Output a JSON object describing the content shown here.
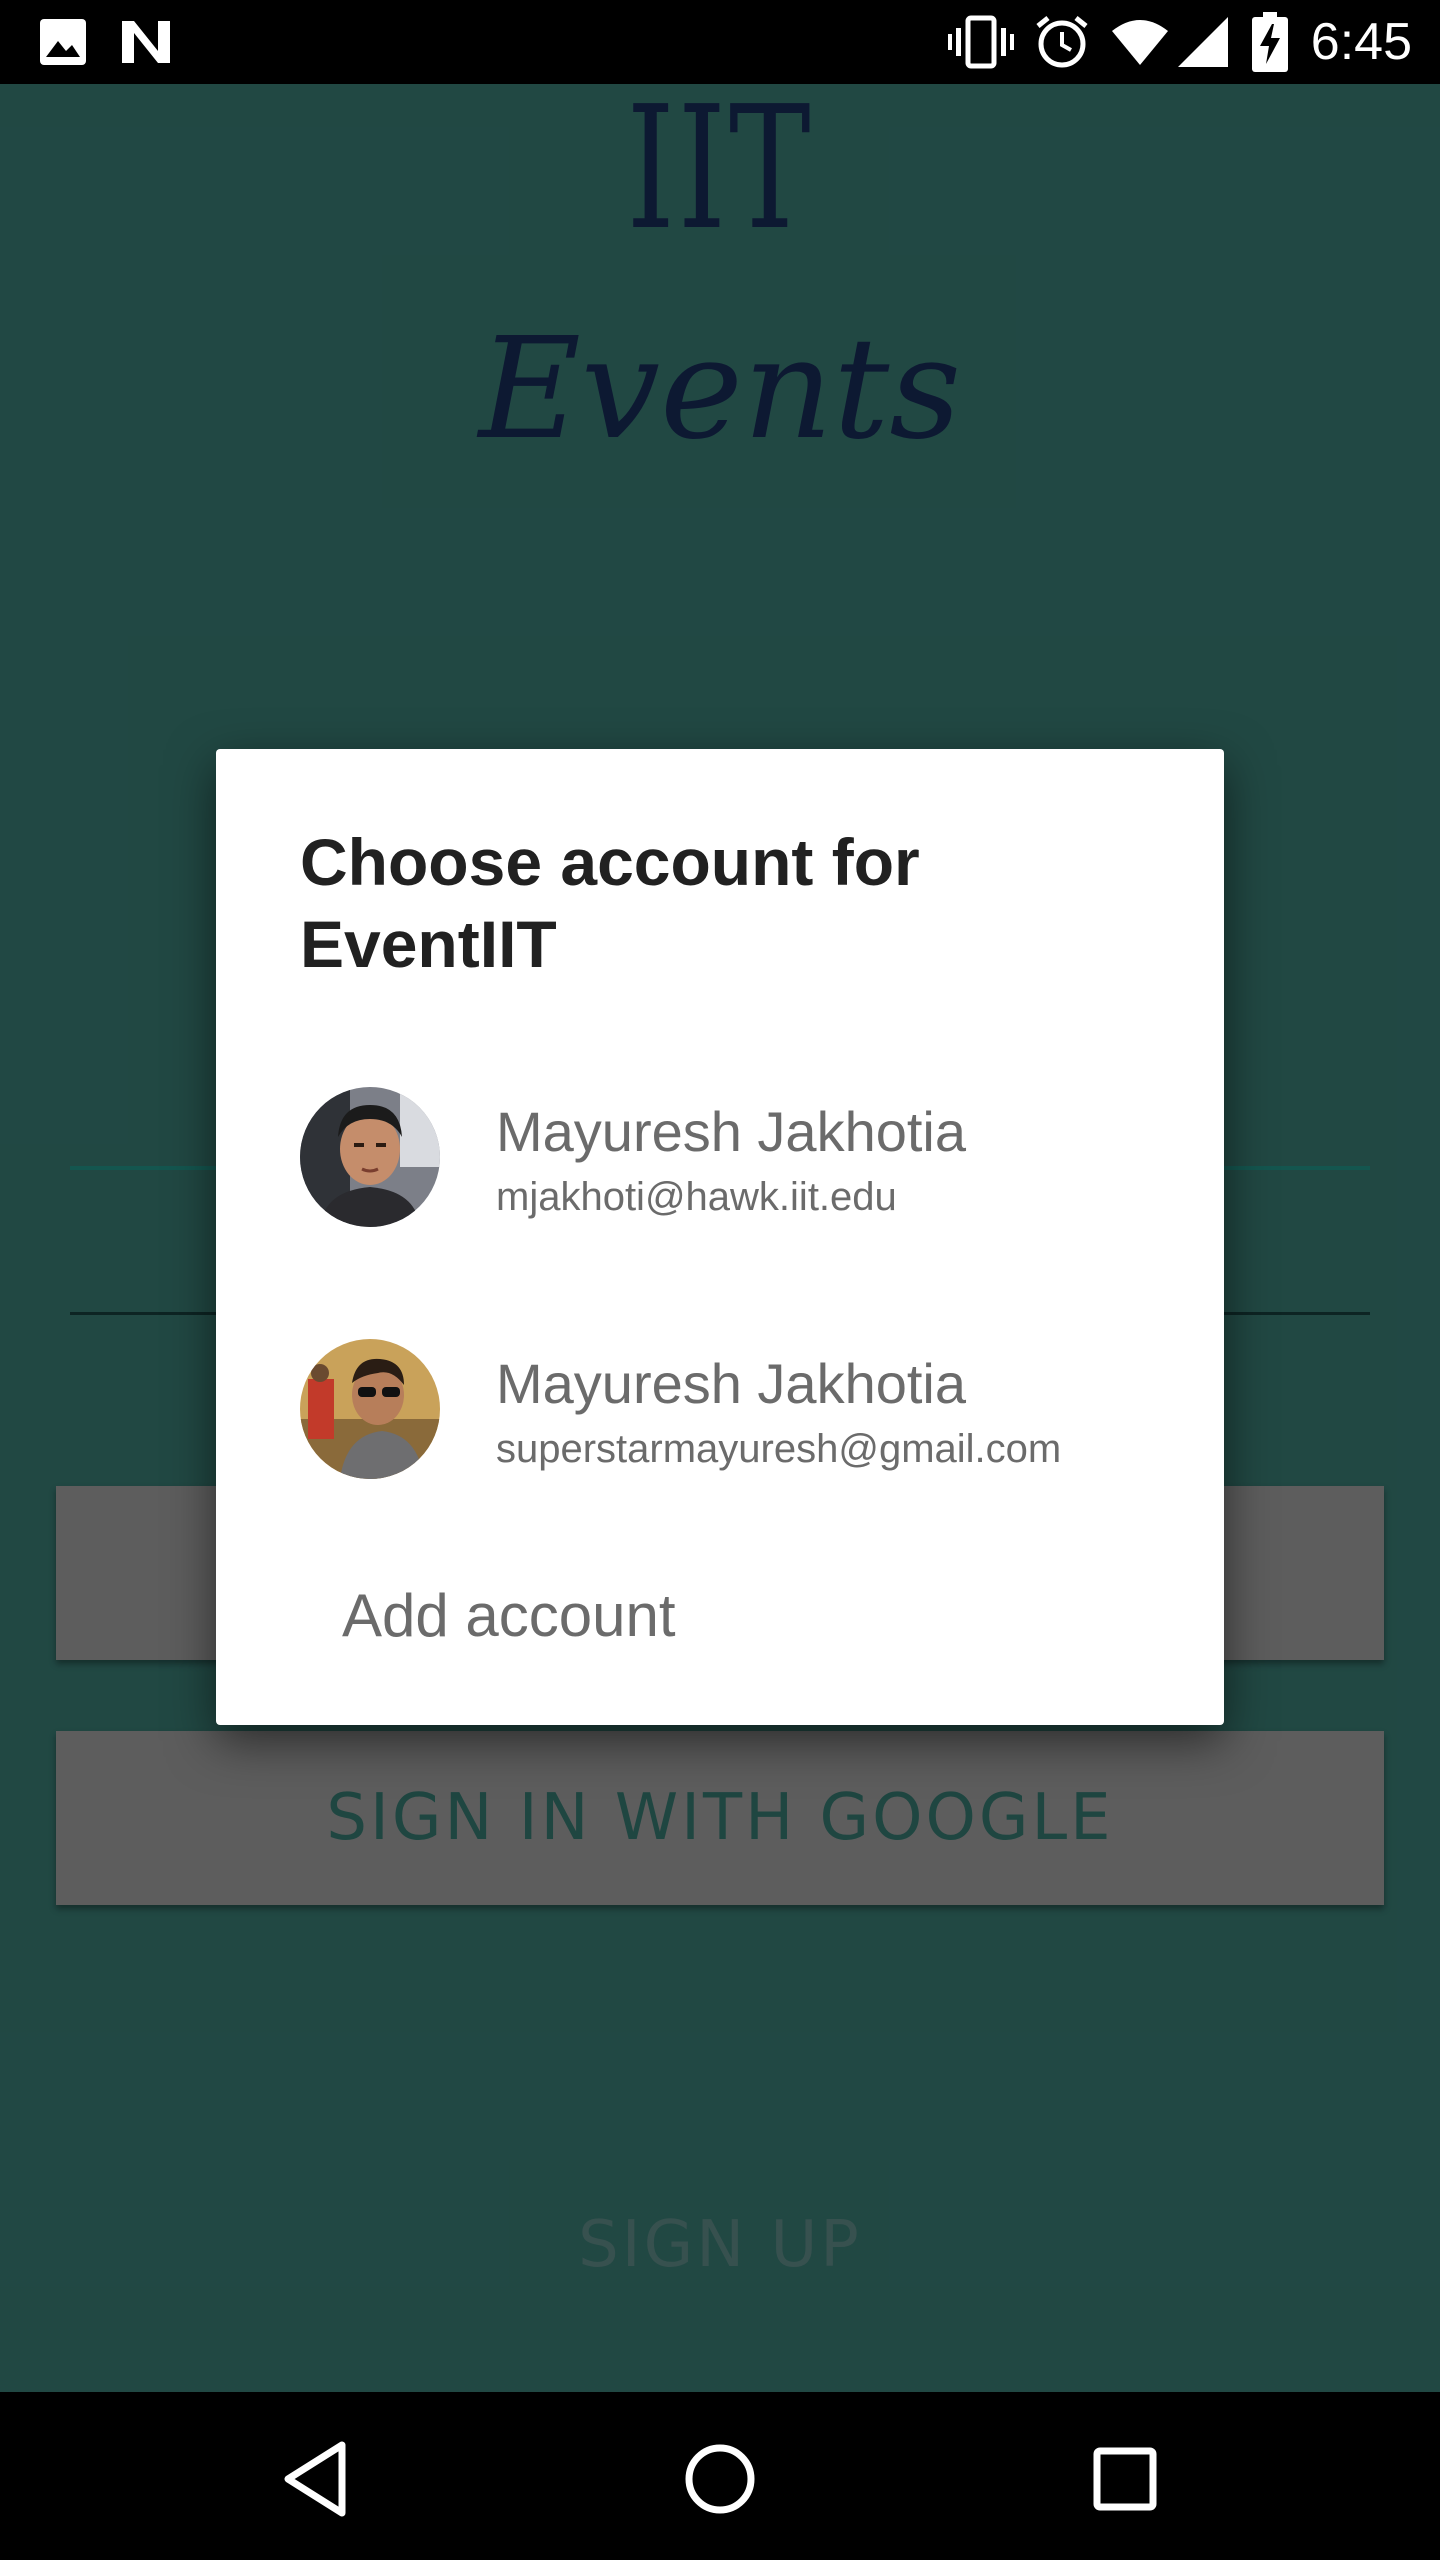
{
  "status_bar": {
    "time": "6:45",
    "icons": [
      "image-icon",
      "n-notification-icon",
      "vibrate-icon",
      "alarm-icon",
      "wifi-icon",
      "signal-icon",
      "battery-charging-icon"
    ]
  },
  "app": {
    "logo_top": "IIT",
    "logo_bottom": "Events",
    "login_button_label": "",
    "google_button_label": "SIGN IN WITH GOOGLE",
    "signup_label": "SIGN UP",
    "colors": {
      "background": "#26524d",
      "accent_line": "#17625a",
      "logo": "#0f1d3a"
    }
  },
  "dialog": {
    "title": "Choose account for EventIIT",
    "accounts": [
      {
        "name": "Mayuresh Jakhotia",
        "email": "mjakhoti@hawk.iit.edu",
        "avatar": "user-photo-1"
      },
      {
        "name": "Mayuresh Jakhotia",
        "email": "superstarmayuresh@gmail.com",
        "avatar": "user-photo-2"
      }
    ],
    "add_account_label": "Add account"
  },
  "nav_bar": {
    "buttons": [
      "back-icon",
      "home-icon",
      "recents-icon"
    ]
  }
}
